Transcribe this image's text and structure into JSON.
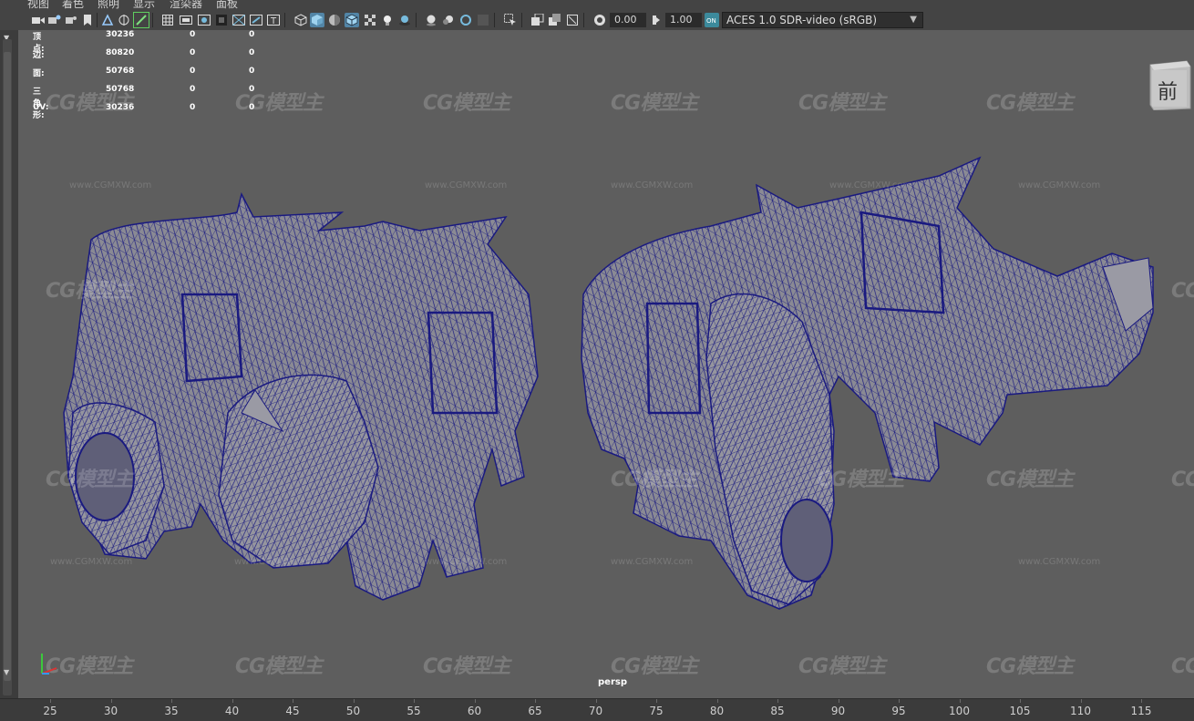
{
  "menu": [
    "视图",
    "着色",
    "照明",
    "显示",
    "渲染器",
    "面板"
  ],
  "toolbar": {
    "exposure_value": "0.00",
    "gamma_value": "1.00",
    "color_space": "ACES 1.0 SDR-video (sRGB)",
    "icons": [
      "camera-icon",
      "camera-attributes-icon",
      "bookmark-icon",
      "image-plane-icon",
      "2d-pan-icon",
      "grease-pencil-icon",
      "grid-icon",
      "film-gate-icon",
      "resolution-gate-icon",
      "gate-mask-icon",
      "field-chart-icon",
      "safe-action-icon",
      "safe-title-icon",
      "wireframe-icon",
      "smooth-shade-icon",
      "default-material-icon",
      "shaded-wireframe-icon",
      "textured-icon",
      "lighting-icon",
      "shadows-icon",
      "screen-space-ao-icon",
      "motion-blur-icon",
      "anti-aliasing-icon",
      "depth-of-field-icon",
      "isolate-select-icon",
      "xray-icon",
      "xray-joints-icon",
      "xray-components-icon",
      "exposure-icon",
      "gamma-icon",
      "color-management-icon"
    ]
  },
  "hud": {
    "rows": [
      {
        "label": "顶点:",
        "v1": "30236",
        "v2": "0",
        "v3": "0"
      },
      {
        "label": "边:",
        "v1": "80820",
        "v2": "0",
        "v3": "0"
      },
      {
        "label": "面:",
        "v1": "50768",
        "v2": "0",
        "v3": "0"
      },
      {
        "label": "三角形:",
        "v1": "50768",
        "v2": "0",
        "v3": "0"
      },
      {
        "label": "UV:",
        "v1": "30236",
        "v2": "0",
        "v3": "0"
      }
    ]
  },
  "viewport": {
    "camera": "persp",
    "viewcube_face": "前",
    "watermark_text": "CG模型主",
    "watermark_url": "www.CGMXW.com"
  },
  "timeline": {
    "ticks": [
      "25",
      "30",
      "35",
      "40",
      "45",
      "50",
      "55",
      "60",
      "65",
      "70",
      "75",
      "80",
      "85",
      "90",
      "95",
      "100",
      "105",
      "110",
      "115"
    ]
  },
  "colors": {
    "viewport_bg": "#5e5e5e",
    "wireframe": "#1a1a80",
    "mesh_fill": "#8a8a94",
    "active_button": "#5285a6"
  }
}
